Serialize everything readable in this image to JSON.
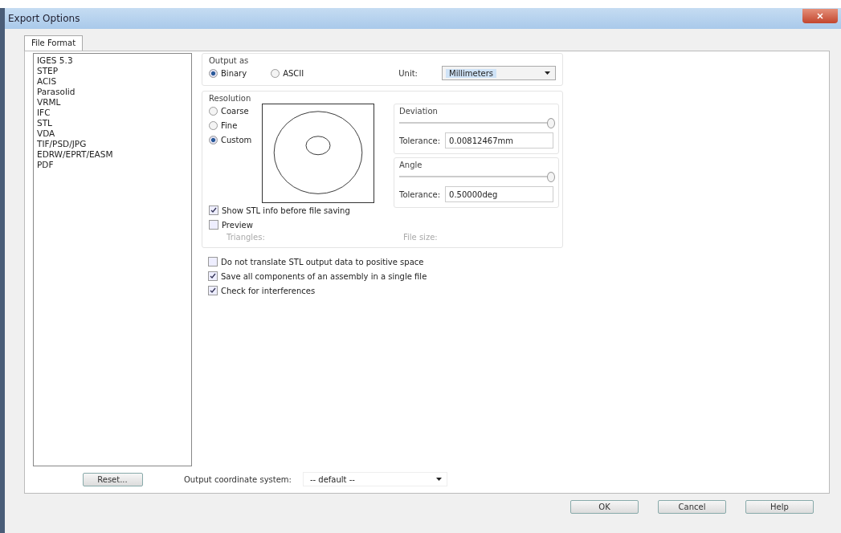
{
  "window": {
    "title": "Export Options"
  },
  "tabs": [
    {
      "label": "File Format",
      "selected": true
    }
  ],
  "formats": [
    "IGES 5.3",
    "STEP",
    "ACIS",
    "Parasolid",
    "VRML",
    "IFC",
    "STL",
    "VDA",
    "TIF/PSD/JPG",
    "EDRW/EPRT/EASM",
    "PDF"
  ],
  "reset_button": "Reset...",
  "output_as": {
    "title": "Output as",
    "options": [
      {
        "label": "Binary",
        "selected": true
      },
      {
        "label": "ASCII",
        "selected": false
      }
    ],
    "unit_label": "Unit:",
    "unit_value": "Millimeters"
  },
  "resolution": {
    "title": "Resolution",
    "options": [
      {
        "label": "Coarse",
        "selected": false
      },
      {
        "label": "Fine",
        "selected": false
      },
      {
        "label": "Custom",
        "selected": true
      }
    ],
    "deviation": {
      "title": "Deviation",
      "level": 1,
      "tolerance_label": "Tolerance:",
      "tolerance_value": "0.00812467mm"
    },
    "angle": {
      "title": "Angle",
      "level": 1,
      "tolerance_label": "Tolerance:",
      "tolerance_value": "0.50000deg"
    },
    "checks": [
      {
        "label": "Show STL info before file saving",
        "checked": true
      },
      {
        "label": "Preview",
        "checked": false
      }
    ],
    "info": [
      {
        "label": "Triangles:",
        "disabled": true
      },
      {
        "label": "File size:",
        "disabled": true
      }
    ]
  },
  "options": [
    {
      "label": "Do not translate STL output data to positive space",
      "checked": false
    },
    {
      "label": "Save all components of an assembly in a single file",
      "checked": true
    },
    {
      "label": "Check for interferences",
      "checked": true
    }
  ],
  "coordinate": {
    "label": "Output coordinate system:",
    "value": "-- default --"
  },
  "buttons": [
    "OK",
    "Cancel",
    "Help"
  ]
}
